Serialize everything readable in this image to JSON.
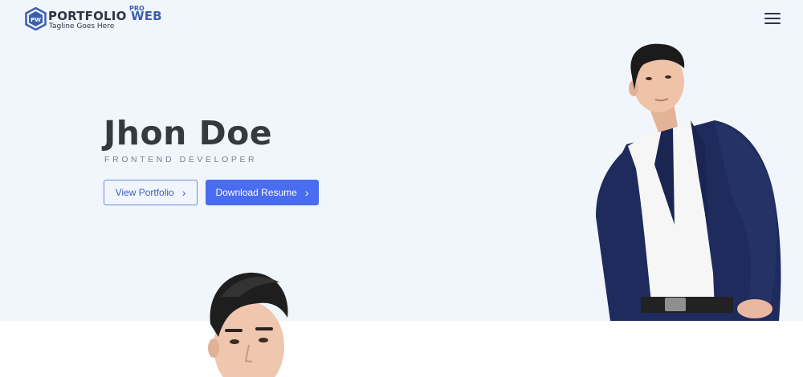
{
  "brand": {
    "logo_badge": "PW",
    "name_primary": "PORTFOLIO",
    "name_accent": "WEB",
    "pro_label": "PRO",
    "tagline": "Tagline Goes Here",
    "accent_color": "#3b5fb0"
  },
  "header": {
    "menu_icon": "hamburger-menu-icon"
  },
  "hero": {
    "name": "Jhon Doe",
    "role": "FRONTEND DEVELOPER",
    "buttons": {
      "view_portfolio": "View Portfolio",
      "download_resume": "Download Resume"
    },
    "background_color": "#f1f6fc",
    "primary_color": "#4a6cf0"
  }
}
